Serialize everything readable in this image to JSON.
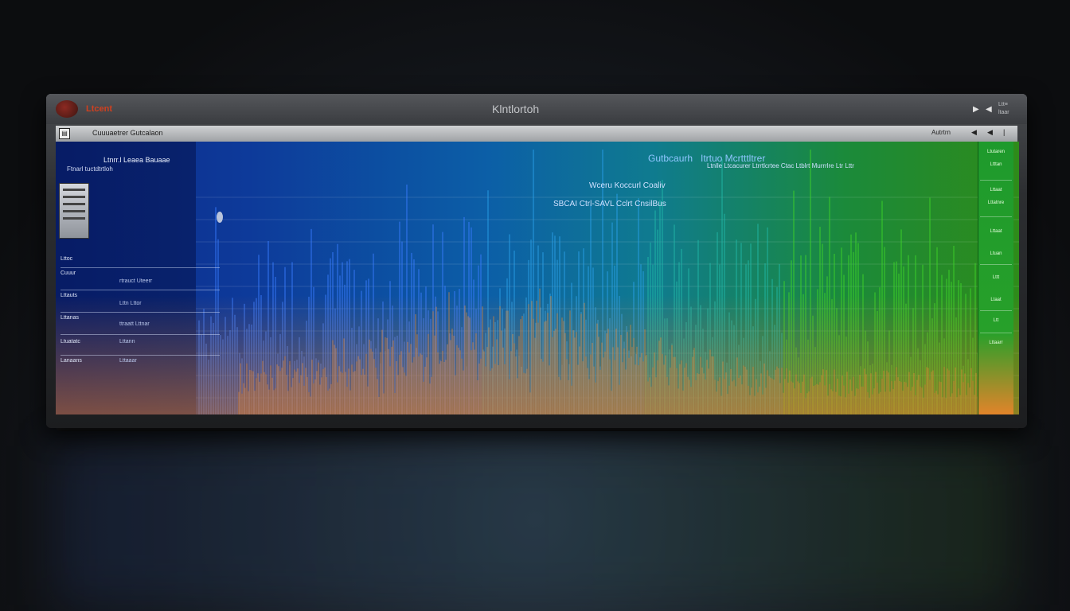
{
  "window": {
    "logo_text": "Ltcent",
    "title": "Klntlortoh",
    "meta_line1": "Ltt≡",
    "meta_line2": "ltaar"
  },
  "toolbar": {
    "label": "Cuuuaetrer Gutcalaon",
    "action_label": "Autrtrn",
    "back_icon": "back-icon",
    "play_icon": "play-icon"
  },
  "left_panel": {
    "heading": "Ltnrr.l Leaea Bauaae",
    "subheading": "Ftnarl tuctdtrtloh",
    "rows": [
      {
        "label": "Lttoc",
        "value": ""
      },
      {
        "label": "Cuuur",
        "value": "rtrauct  Uteerr"
      },
      {
        "label": "Lttauts",
        "value": "Lttn  Lttor"
      },
      {
        "label": "Lttanas",
        "value": "ttraatt  Lttnar"
      },
      {
        "label": "Ltuatatc",
        "value": "Lttann"
      },
      {
        "label": "Lanaans",
        "value": "Lttaaar"
      }
    ]
  },
  "center": {
    "heading": "Gutbcaurh",
    "subheading": "Itrtuo Mcrtttltrer",
    "info_line": "Ltnlle Ltcacurer Ltrrtlcrtee  Ctac Ltblrt Murrrlre Ltr  Lttr",
    "label1": "Wceru Koccurl Coaliv",
    "label2": "SBCAI Ctrl-SAVL Cclrt CnsilBus"
  },
  "sidebar": {
    "items": [
      "Ltutaren",
      "Ltttan",
      "Lttaat",
      "Lttatnre",
      "Lttaat",
      "Ltuan",
      "Lttt",
      "Ltaat",
      "Ltt",
      "Lttaarr"
    ]
  },
  "colors": {
    "deep_blue": "#0c2a88",
    "teal": "#0f7b8f",
    "green": "#2e8b1a",
    "orange": "#e2842a",
    "sidebar_green": "#27a02a"
  }
}
